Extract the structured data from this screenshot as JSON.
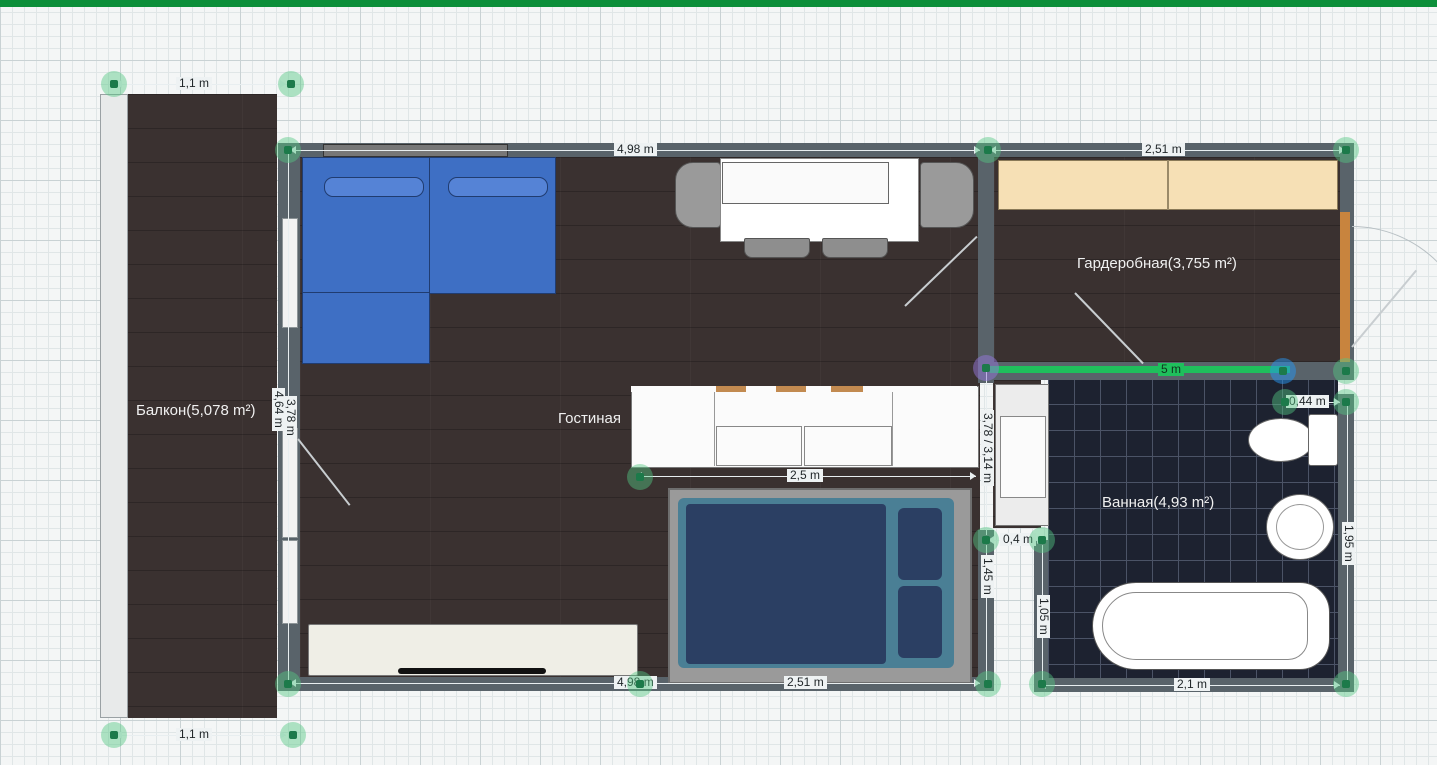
{
  "rooms": {
    "balcony": "Балкон(5,078 m²)",
    "living": "Гостиная",
    "wardrobe": "Гардеробная(3,755 m²)",
    "bath": "Ванная(4,93 m²)"
  },
  "dims": {
    "balcony_top": "1,1 m",
    "balcony_bottom": "1,1 m",
    "living_top": "4,98 m",
    "living_bottom": "4,98 m",
    "bed_bottom": "2,51 m",
    "wardrobe_top": "2,51 m",
    "living_left_outer": "4,64 m",
    "living_left_inner": "3,78 m",
    "counter_width": "2,5 m",
    "wall_green": "5 m",
    "toilet_top": "0,44 m",
    "bath_right": "1,95 m",
    "bath_bottom": "2,1 m",
    "bath_left_lower": "1,05 m",
    "niche_width": "0,4 m",
    "niche_height": "1,45 m",
    "center_vertical": "3,78 / 3,14 m"
  },
  "colors": {
    "topbar": "#0c8f3a",
    "sofa": "#3e6fc4",
    "floor": "#3a3130",
    "tiles": "#1d2230"
  }
}
